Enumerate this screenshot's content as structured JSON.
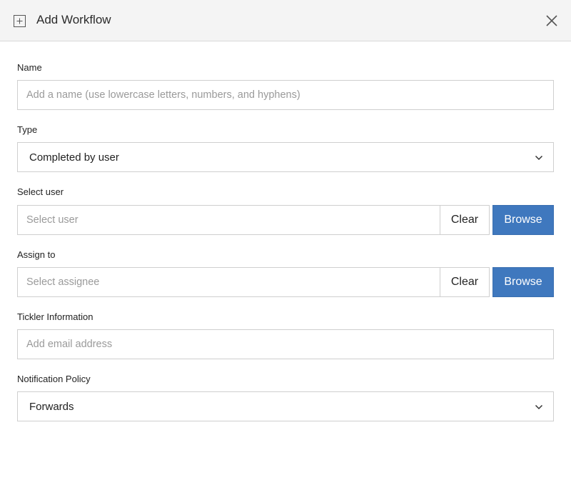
{
  "dialog": {
    "title": "Add Workflow"
  },
  "form": {
    "name": {
      "label": "Name",
      "placeholder": "Add a name (use lowercase letters, numbers, and hyphens)",
      "value": ""
    },
    "type": {
      "label": "Type",
      "selected": "Completed by user"
    },
    "select_user": {
      "label": "Select user",
      "placeholder": "Select user",
      "clear_label": "Clear",
      "browse_label": "Browse"
    },
    "assign_to": {
      "label": "Assign to",
      "placeholder": "Select assignee",
      "clear_label": "Clear",
      "browse_label": "Browse"
    },
    "tickler": {
      "label": "Tickler Information",
      "placeholder": "Add email address"
    },
    "notification_policy": {
      "label": "Notification Policy",
      "selected": "Forwards"
    }
  },
  "colors": {
    "accent": "#3f78be",
    "header_bg": "#f4f4f4",
    "border": "#cfcfcf"
  },
  "icons": {
    "header": "add-box-icon",
    "close": "close-icon",
    "select": "chevron-down-icon"
  }
}
